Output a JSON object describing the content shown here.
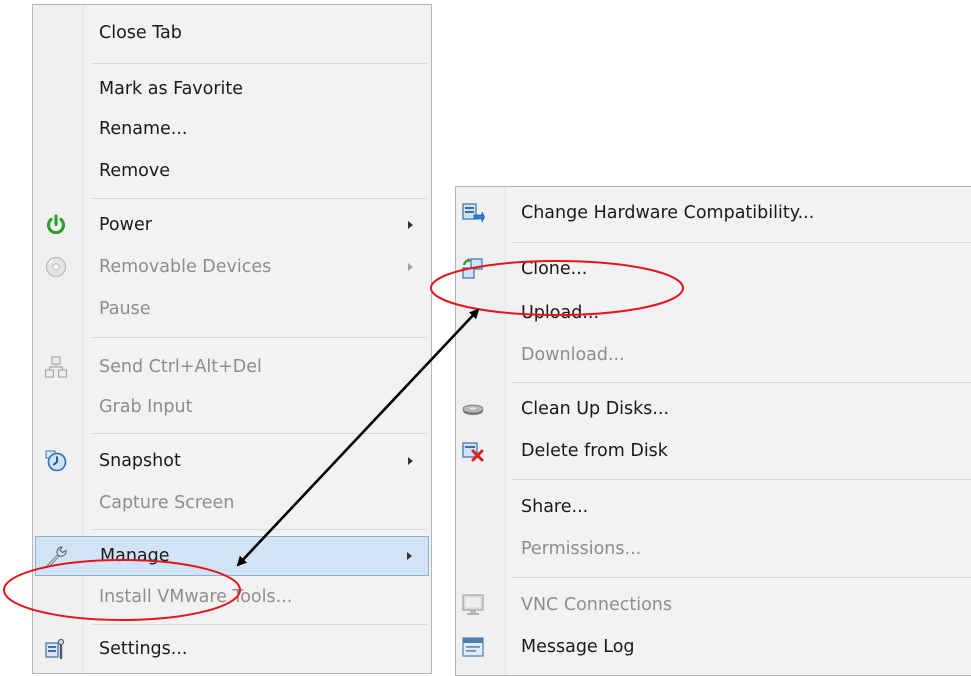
{
  "main_menu": {
    "items": [
      {
        "label": "Close Tab",
        "enabled": true
      },
      {
        "label": "Mark as Favorite",
        "enabled": true
      },
      {
        "label": "Rename...",
        "enabled": true
      },
      {
        "label": "Remove",
        "enabled": true
      },
      {
        "label": "Power",
        "enabled": true,
        "icon": "power-icon",
        "submenu": true
      },
      {
        "label": "Removable Devices",
        "enabled": false,
        "icon": "disc-icon",
        "submenu": true
      },
      {
        "label": "Pause",
        "enabled": false
      },
      {
        "label": "Send Ctrl+Alt+Del",
        "enabled": false,
        "icon": "keyboard-network-icon"
      },
      {
        "label": "Grab Input",
        "enabled": false
      },
      {
        "label": "Snapshot",
        "enabled": true,
        "icon": "snapshot-clock-icon",
        "submenu": true
      },
      {
        "label": "Capture Screen",
        "enabled": false
      },
      {
        "label": "Manage",
        "enabled": true,
        "icon": "wrench-icon",
        "submenu": true,
        "highlighted": true
      },
      {
        "label": "Install VMware Tools...",
        "enabled": false
      },
      {
        "label": "Settings...",
        "enabled": true,
        "icon": "settings-icon"
      }
    ]
  },
  "manage_submenu": {
    "items": [
      {
        "label": "Change Hardware Compatibility...",
        "enabled": true,
        "icon": "hardware-compatibility-icon"
      },
      {
        "label": "Clone...",
        "enabled": true,
        "icon": "clone-icon"
      },
      {
        "label": "Upload...",
        "enabled": true
      },
      {
        "label": "Download...",
        "enabled": false
      },
      {
        "label": "Clean Up Disks...",
        "enabled": true,
        "icon": "disk-icon"
      },
      {
        "label": "Delete from Disk",
        "enabled": true,
        "icon": "delete-disk-icon"
      },
      {
        "label": "Share...",
        "enabled": true
      },
      {
        "label": "Permissions...",
        "enabled": false
      },
      {
        "label": "VNC Connections",
        "enabled": false,
        "icon": "monitor-icon"
      },
      {
        "label": "Message Log",
        "enabled": true,
        "icon": "message-log-icon"
      }
    ]
  },
  "annotations": {
    "stroke_colors": {
      "ellipse": "#e8141b",
      "arrow": "#000000"
    },
    "circled_items": [
      "Manage",
      "Clone..."
    ]
  }
}
